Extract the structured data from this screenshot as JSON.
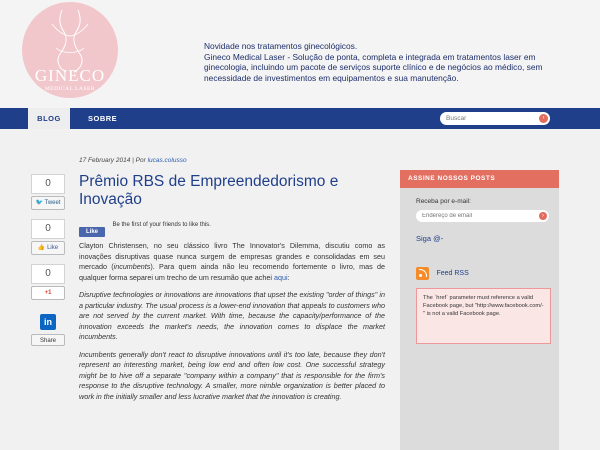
{
  "header": {
    "logo_text": "GINECO",
    "logo_sub": "MEDICAL LASER",
    "tagline": "Novidade nos tratamentos ginecológicos.\nGineco Medical Laser - Solução de ponta, completa e integrada em tratamentos laser em ginecologia, incluindo um pacote de serviços suporte clínico e de negócios ao médico, sem necessidade de investimentos em equipamentos e sua manutenção."
  },
  "nav": {
    "items": [
      "BLOG",
      "SOBRE"
    ],
    "search_placeholder": "Buscar"
  },
  "social": {
    "tweet_count": "0",
    "tweet_label": "Tweet",
    "like_count": "0",
    "like_label": "Like",
    "gplus_count": "0",
    "gplus_label": "+1",
    "in_share_label": "Share"
  },
  "article": {
    "date": "17 February 2014",
    "by_prefix": "Por",
    "author": "lucas.colusso",
    "title": "Prêmio RBS de Empreendedorismo e Inovação",
    "fb_like": "Like",
    "fb_like_text": "Be the first of your friends to like this.",
    "p1_before": "Clayton Christensen, no seu clássico livro The Innovator's Dilemma, discutiu como as inovações disruptivas quase nunca surgem de empresas grandes e consolidadas em seu mercado (",
    "p1_italic": "incumbents",
    "p1_after": "). Para quem ainda não leu recomendo fortemente o livro, mas de qualquer forma separei um trecho de um resumão que achei ",
    "p1_link": "aqui",
    "p1_end": ":",
    "p2": "Disruptive technologies or innovations are innovations that upset the existing \"order of things\" in a particular industry. The usual process is a lower-end innovation that appeals to customers who are not served by the current market. With time, because the capacity/performance of the innovation exceeds the market's needs, the innovation comes to displace the market incumbents.",
    "p3": "Incumbents generally don't react to disruptive innovations until it's too late, because they don't represent an interesting market, being low end and often low cost. One successful strategy might be to hive off a separate \"company within a company\" that is responsible for the firm's response to the disruptive technology. A smaller, more nimble organization is better placed to work in the initially smaller and less lucrative market that the innovation is creating."
  },
  "sidebar": {
    "title": "ASSINE NOSSOS POSTS",
    "email_label": "Receba por e-mail:",
    "email_placeholder": "Endereço de email",
    "siga": "Siga @-",
    "feed": "Feed RSS",
    "error": "The `href` parameter must reference a valid Facebook page, but \"http://www.facebook.com/-\" is not a valid Facebook page."
  },
  "colors": {
    "nav": "#1f3f8a",
    "accent": "#e36f61",
    "logo": "#f2c7cc"
  }
}
